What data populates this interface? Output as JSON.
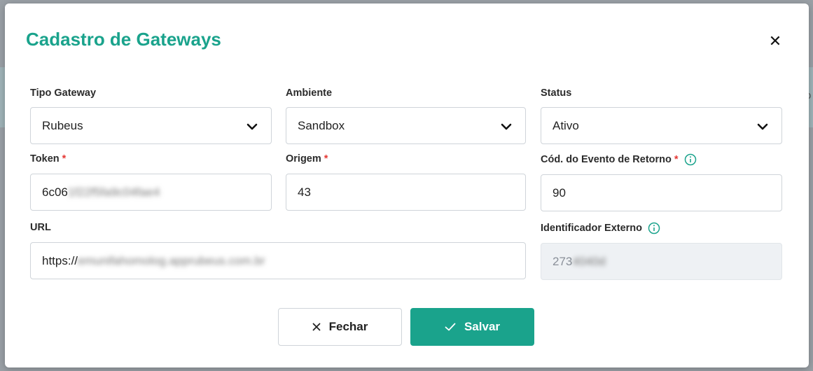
{
  "backdrop": {
    "peek_char": "o"
  },
  "modal": {
    "title": "Cadastro de Gateways",
    "close_icon": "close-icon"
  },
  "fields": {
    "tipo_gateway": {
      "label": "Tipo Gateway",
      "value": "Rubeus"
    },
    "ambiente": {
      "label": "Ambiente",
      "value": "Sandbox"
    },
    "status": {
      "label": "Status",
      "value": "Ativo"
    },
    "token": {
      "label": "Token",
      "required": "*",
      "value_visible": "6c06",
      "value_obscured": "1f22f5fa9c04fae4"
    },
    "origem": {
      "label": "Origem",
      "required": "*",
      "value": "43"
    },
    "cod_evento": {
      "label": "Cód. do Evento de Retorno",
      "required": "*",
      "value": "90",
      "icon": "info-icon"
    },
    "url": {
      "label": "URL",
      "value_visible": "https://",
      "value_obscured": "emunifahomolog.apprubeus.com.br"
    },
    "identificador": {
      "label": "Identificador Externo",
      "value_visible": "273",
      "value_obscured": "4040d",
      "icon": "info-icon"
    }
  },
  "buttons": {
    "close_label": "Fechar",
    "save_label": "Salvar"
  },
  "colors": {
    "accent": "#1aa38c",
    "required": "#e53935"
  }
}
